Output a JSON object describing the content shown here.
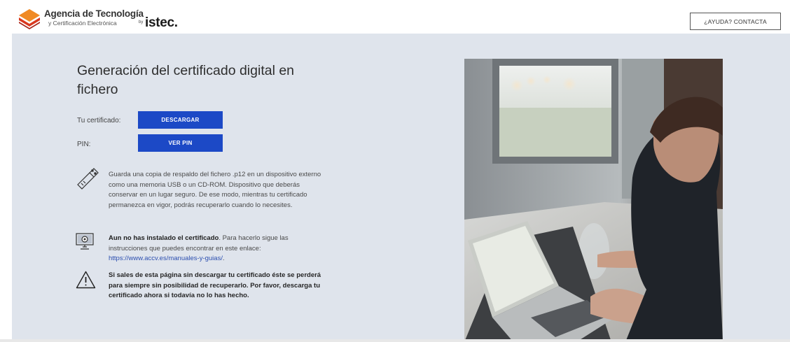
{
  "header": {
    "brand_name": "Agencia de Tecnología",
    "brand_sub": "y Certificación Electrónica",
    "by": "by",
    "istec": "istec.",
    "help_button": "¿AYUDA? CONTACTA"
  },
  "main": {
    "title": "Generación del certificado digital en fichero",
    "cert_label": "Tu certificado:",
    "download_button": "DESCARGAR",
    "pin_label": "PIN:",
    "pin_button": "VER PIN",
    "notes": {
      "usb": "Guarda una copia de respaldo del fichero .p12 en un dispositivo externo como una memoria USB o un CD-ROM. Dispositivo que deberás conservar en un lugar seguro. De ese modo, mientras tu certificado permanezca en vigor, podrás recuperarlo cuando lo necesites.",
      "install_bold": "Aun no has instalado el certificado",
      "install_text": ". Para hacerlo sigue las instrucciones que puedes encontrar en este enlace:",
      "install_link": "https://www.accv.es/manuales-y-guias/",
      "install_end": ".",
      "warning": "Si sales de esta página sin descargar tu certificado éste se perderá para siempre sin posibilidad de recuperarlo. Por favor, descarga tu certificado ahora si todavía no lo has hecho."
    }
  },
  "icons": [
    "logo-icon",
    "usb-icon",
    "computer-settings-icon",
    "warning-icon"
  ],
  "colors": {
    "primary_button": "#1c49c6",
    "background_panel": "#dfe4ec",
    "logo_red": "#d9381e",
    "logo_orange": "#f08a24",
    "link": "#2c4fb0"
  }
}
